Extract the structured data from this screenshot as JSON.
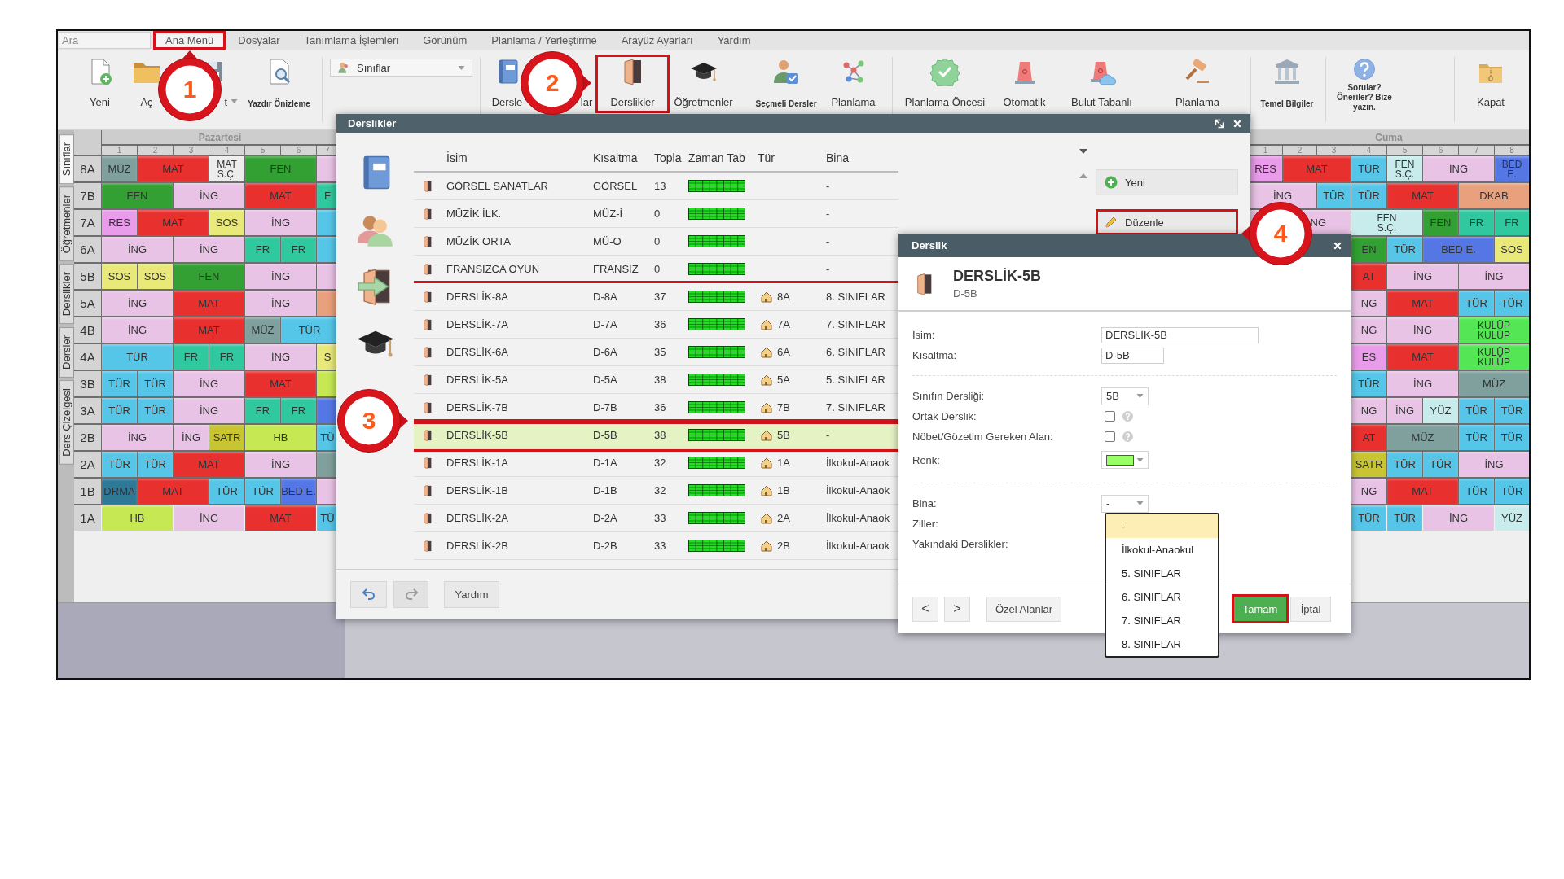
{
  "search": {
    "placeholder": "Ara"
  },
  "menu": [
    {
      "label": "Ana Menü",
      "selected": true,
      "highlighted": true
    },
    {
      "label": "Dosyalar",
      "selected": false,
      "highlighted": false
    },
    {
      "label": "Tanımlama İşlemleri",
      "selected": false,
      "highlighted": false
    },
    {
      "label": "Görünüm",
      "selected": false,
      "highlighted": false
    },
    {
      "label": "Planlama / Yerleştirme",
      "selected": false,
      "highlighted": false
    },
    {
      "label": "Arayüz Ayarları",
      "selected": false,
      "highlighted": false
    },
    {
      "label": "Yardım",
      "selected": false,
      "highlighted": false
    }
  ],
  "toolbar": [
    {
      "kind": "large",
      "label": "Yeni",
      "highlighted": false
    },
    {
      "kind": "large",
      "label": "Aç",
      "highlighted": false
    },
    {
      "kind": "menu",
      "label": "t",
      "highlighted": false
    },
    {
      "kind": "small",
      "label": "Yazdır Önizleme",
      "highlighted": false
    },
    {
      "kind": "select",
      "value": "Sınıflar",
      "highlighted": false
    },
    {
      "kind": "large",
      "label": "Dersle",
      "highlighted": false
    },
    {
      "kind": "large",
      "label": "lar",
      "highlighted": false
    },
    {
      "kind": "large",
      "label": "Derslikler",
      "highlighted": true
    },
    {
      "kind": "large",
      "label": "Öğretmenler",
      "highlighted": false
    },
    {
      "kind": "small",
      "label": "Seçmeli Dersler",
      "highlighted": false
    },
    {
      "kind": "large",
      "label": "Planlama",
      "highlighted": false
    },
    {
      "kind": "large",
      "label": "Planlama Öncesi",
      "highlighted": false
    },
    {
      "kind": "large",
      "label": "Otomatik",
      "highlighted": false
    },
    {
      "kind": "large",
      "label": "Bulut Tabanlı",
      "highlighted": false
    },
    {
      "kind": "large",
      "label": "Planlama",
      "highlighted": false
    },
    {
      "kind": "small",
      "label": "Temel Bilgiler",
      "highlighted": false
    },
    {
      "kind": "small",
      "label": "Sorular? Öneriler? Bize yazın.",
      "highlighted": false
    },
    {
      "kind": "large",
      "label": "Kapat",
      "highlighted": false
    }
  ],
  "view_tabs": [
    {
      "label": "Sınıflar",
      "selected": true
    },
    {
      "label": "Öğretmenler",
      "selected": false
    },
    {
      "label": "Derslikler",
      "selected": false
    },
    {
      "label": "Dersler",
      "selected": false
    },
    {
      "label": "Ders Çizelgesi",
      "selected": false
    }
  ],
  "timetable_left": {
    "day": "Pazartesi",
    "periods": [
      "1",
      "2",
      "3",
      "4",
      "5",
      "6",
      "7"
    ],
    "rows": [
      {
        "class": "8A",
        "cells": [
          {
            "text": "MÜZ",
            "color": "#7fa09c"
          },
          {
            "text": "MAT",
            "color": "#e8302f"
          },
          {
            "lines": [
              "MAT",
              "S.Ç."
            ],
            "color": "#ececec"
          },
          {
            "text": "FEN",
            "color": "#32a032"
          },
          {
            "color": "#e9c3e6"
          }
        ]
      },
      {
        "class": "7B",
        "cells": [
          {
            "text": "FEN",
            "color": "#32a032"
          },
          {
            "text": "İNG",
            "color": "#e9c3e6"
          },
          {
            "text": "MAT",
            "color": "#e8302f"
          },
          {
            "text": "F",
            "color": "#30c89e"
          }
        ]
      },
      {
        "class": "7A",
        "cells": [
          {
            "text": "RES",
            "color": "#e99ce9"
          },
          {
            "text": "MAT",
            "color": "#e8302f"
          },
          {
            "text": "SOS",
            "color": "#e9e97a"
          },
          {
            "text": "İNG",
            "color": "#e9c3e6"
          },
          {
            "color": "#56c6e8"
          }
        ]
      },
      {
        "class": "6A",
        "cells": [
          {
            "text": "İNG",
            "color": "#e9c3e6"
          },
          {
            "text": "İNG",
            "color": "#e9c3e6"
          },
          {
            "text": "FR",
            "color": "#30c89e"
          },
          {
            "text": "FR",
            "color": "#30c89e"
          },
          {
            "color": "#56c6e8"
          }
        ]
      },
      {
        "class": "5B",
        "cells": [
          {
            "text": "SOS",
            "color": "#e9e97a"
          },
          {
            "text": "SOS",
            "color": "#e9e97a"
          },
          {
            "text": "FEN",
            "color": "#32a032"
          },
          {
            "text": "İNG",
            "color": "#e9c3e6"
          },
          {
            "color": "#e9c3e6"
          }
        ]
      },
      {
        "class": "5A",
        "cells": [
          {
            "text": "İNG",
            "color": "#e9c3e6"
          },
          {
            "text": "MAT",
            "color": "#e8302f"
          },
          {
            "text": "İNG",
            "color": "#e9c3e6"
          },
          {
            "color": "#e9a07c"
          }
        ]
      },
      {
        "class": "4B",
        "cells": [
          {
            "text": "İNG",
            "color": "#e9c3e6"
          },
          {
            "text": "MAT",
            "color": "#e8302f"
          },
          {
            "text": "MÜZ",
            "color": "#7fa09c"
          },
          {
            "text": "TÜR",
            "color": "#56c6e8"
          }
        ]
      },
      {
        "class": "4A",
        "cells": [
          {
            "text": "TÜR",
            "color": "#56c6e8"
          },
          {
            "text": "FR",
            "color": "#30c89e"
          },
          {
            "text": "FR",
            "color": "#30c89e"
          },
          {
            "text": "İNG",
            "color": "#e9c3e6"
          },
          {
            "text": "S",
            "color": "#e9e97a"
          }
        ]
      },
      {
        "class": "3B",
        "cells": [
          {
            "text": "TÜR",
            "color": "#56c6e8"
          },
          {
            "text": "TÜR",
            "color": "#56c6e8"
          },
          {
            "text": "İNG",
            "color": "#e9c3e6"
          },
          {
            "text": "MAT",
            "color": "#e8302f"
          },
          {
            "color": "#c6e852"
          }
        ]
      },
      {
        "class": "3A",
        "cells": [
          {
            "text": "TÜR",
            "color": "#56c6e8"
          },
          {
            "text": "TÜR",
            "color": "#56c6e8"
          },
          {
            "text": "İNG",
            "color": "#e9c3e6"
          },
          {
            "text": "FR",
            "color": "#30c89e"
          },
          {
            "text": "FR",
            "color": "#30c89e"
          },
          {
            "color": "#5577e6"
          }
        ]
      },
      {
        "class": "2B",
        "cells": [
          {
            "text": "İNG",
            "color": "#e9c3e6"
          },
          {
            "text": "İNG",
            "color": "#e9c3e6"
          },
          {
            "text": "SATR",
            "color": "#c8c432"
          },
          {
            "text": "HB",
            "color": "#c6e852"
          },
          {
            "text": "TÜ",
            "color": "#56c6e8"
          }
        ]
      },
      {
        "class": "2A",
        "cells": [
          {
            "text": "TÜR",
            "color": "#56c6e8"
          },
          {
            "text": "TÜR",
            "color": "#56c6e8"
          },
          {
            "text": "MAT",
            "color": "#e8302f"
          },
          {
            "text": "İNG",
            "color": "#e9c3e6"
          },
          {
            "color": "#7fa09c"
          }
        ]
      },
      {
        "class": "1B",
        "cells": [
          {
            "text": "DRMA",
            "color": "#2e7898"
          },
          {
            "text": "MAT",
            "color": "#e8302f"
          },
          {
            "text": "TÜR",
            "color": "#56c6e8"
          },
          {
            "text": "TÜR",
            "color": "#56c6e8"
          },
          {
            "text": "BED E.",
            "color": "#5577e6"
          },
          {
            "color": "#e9c3e6"
          }
        ]
      },
      {
        "class": "1A",
        "cells": [
          {
            "text": "HB",
            "color": "#c6e852"
          },
          {
            "text": "İNG",
            "color": "#e9c3e6"
          },
          {
            "text": "MAT",
            "color": "#e8302f"
          },
          {
            "text": "TÜ",
            "color": "#56c6e8"
          }
        ]
      }
    ]
  },
  "timetable_right": {
    "day": "Cuma",
    "periods": [
      "1",
      "2",
      "3",
      "4",
      "5",
      "6",
      "7",
      "8"
    ],
    "rows": [
      {
        "cells": [
          {
            "text": "RES",
            "color": "#e99ce9"
          },
          {
            "text": "MAT",
            "color": "#e8302f"
          },
          {
            "text": "TÜR",
            "color": "#56c6e8"
          },
          {
            "lines": [
              "FEN",
              "S.Ç."
            ],
            "color": "#c8ecec"
          },
          {
            "text": "İNG",
            "color": "#e9c3e6"
          },
          {
            "lines": [
              "BED",
              "E."
            ],
            "color": "#5577e6"
          }
        ]
      },
      {
        "cells": [
          {
            "text": "İNG",
            "color": "#e9c3e6"
          },
          {
            "text": "TÜR",
            "color": "#56c6e8"
          },
          {
            "text": "TÜR",
            "color": "#56c6e8"
          },
          {
            "text": "MAT",
            "color": "#e8302f"
          },
          {
            "text": "DKAB",
            "color": "#e9a07c"
          }
        ]
      },
      {
        "cells": [
          {
            "color": "#e9c3e6"
          },
          {
            "text": "NG",
            "color": "#e9c3e6"
          },
          {
            "lines": [
              "FEN",
              "S.Ç."
            ],
            "color": "#c8ecec"
          },
          {
            "text": "FEN",
            "color": "#32a032"
          },
          {
            "text": "FR",
            "color": "#30c89e"
          },
          {
            "text": "FR",
            "color": "#30c89e"
          }
        ]
      },
      {
        "cells": [
          "",
          "",
          "",
          {
            "text": "EN",
            "color": "#32a032"
          },
          {
            "text": "TÜR",
            "color": "#56c6e8"
          },
          {
            "text": "BED E.",
            "color": "#5577e6"
          },
          {
            "text": "SOS",
            "color": "#e9e97a"
          }
        ]
      },
      {
        "cells": [
          "",
          "",
          "",
          {
            "text": "AT",
            "color": "#e8302f"
          },
          {
            "text": "İNG",
            "color": "#e9c3e6"
          },
          {
            "text": "İNG",
            "color": "#e9c3e6"
          }
        ]
      },
      {
        "cells": [
          "",
          "",
          "",
          {
            "text": "NG",
            "color": "#e9c3e6"
          },
          {
            "text": "MAT",
            "color": "#e8302f"
          },
          {
            "text": "TÜR",
            "color": "#56c6e8"
          },
          {
            "text": "TÜR",
            "color": "#56c6e8"
          }
        ]
      },
      {
        "cells": [
          "",
          "",
          "",
          {
            "text": "NG",
            "color": "#e9c3e6"
          },
          {
            "text": "İNG",
            "color": "#e9c3e6"
          },
          {
            "lines": [
              "KULÜP",
              "KULÜP"
            ],
            "color": "#55e655"
          }
        ]
      },
      {
        "cells": [
          "",
          "",
          "",
          {
            "text": "ES",
            "color": "#e99ce9"
          },
          {
            "text": "MAT",
            "color": "#e8302f"
          },
          {
            "lines": [
              "KULÜP",
              "KULÜP"
            ],
            "color": "#55e655"
          }
        ]
      },
      {
        "cells": [
          "",
          "",
          "",
          {
            "text": "TÜR",
            "color": "#56c6e8"
          },
          {
            "text": "İNG",
            "color": "#e9c3e6"
          },
          {
            "text": "MÜZ",
            "color": "#7fa09c"
          }
        ]
      },
      {
        "cells": [
          "",
          "",
          "",
          {
            "text": "NG",
            "color": "#e9c3e6"
          },
          {
            "text": "İNG",
            "color": "#e9c3e6"
          },
          {
            "text": "YÜZ",
            "color": "#c8ecec"
          },
          {
            "text": "TÜR",
            "color": "#56c6e8"
          },
          {
            "text": "TÜR",
            "color": "#56c6e8"
          }
        ]
      },
      {
        "cells": [
          "",
          "",
          "",
          {
            "text": "AT",
            "color": "#e8302f"
          },
          {
            "text": "MÜZ",
            "color": "#7fa09c"
          },
          {
            "text": "TÜR",
            "color": "#56c6e8"
          },
          {
            "text": "TÜR",
            "color": "#56c6e8"
          }
        ]
      },
      {
        "cells": [
          "",
          "",
          "",
          {
            "text": "SATR",
            "color": "#c8c432"
          },
          {
            "text": "TÜR",
            "color": "#56c6e8"
          },
          {
            "text": "TÜR",
            "color": "#56c6e8"
          },
          {
            "text": "İNG",
            "color": "#e9c3e6"
          }
        ]
      },
      {
        "cells": [
          "",
          "",
          "",
          {
            "text": "NG",
            "color": "#e9c3e6"
          },
          {
            "text": "MAT",
            "color": "#e8302f"
          },
          {
            "text": "TÜR",
            "color": "#56c6e8"
          },
          {
            "text": "TÜR",
            "color": "#56c6e8"
          }
        ]
      },
      {
        "cells": [
          "",
          "",
          "",
          {
            "text": "TÜR",
            "color": "#56c6e8"
          },
          {
            "text": "TÜR",
            "color": "#56c6e8"
          },
          {
            "text": "İNG",
            "color": "#e9c3e6"
          },
          {
            "text": "YÜZ",
            "color": "#c8ecec"
          }
        ]
      }
    ]
  },
  "rooms_window": {
    "title": "Derslikler",
    "columns": [
      "İsim",
      "Kısaltma",
      "Topla",
      "Zaman Tab",
      "Tür",
      "Bina"
    ],
    "rows": [
      {
        "name": "GÖRSEL SANATLAR",
        "short": "GÖRSEL",
        "total": "13",
        "building": "-",
        "selected": false,
        "framed": false
      },
      {
        "name": "MÜZİK İLK.",
        "short": "MÜZ-İ",
        "total": "0",
        "building": "-",
        "selected": false,
        "framed": false
      },
      {
        "name": "MÜZİK ORTA",
        "short": "MÜ-O",
        "total": "0",
        "building": "-",
        "selected": false,
        "framed": false
      },
      {
        "name": "FRANSIZCA OYUN",
        "short": "FRANSIZ",
        "total": "0",
        "building": "-",
        "selected": false,
        "framed": false
      },
      {
        "name": "DERSLİK-8A",
        "short": "D-8A",
        "total": "37",
        "class": "8A",
        "building": "8. SINIFLAR",
        "selected": false,
        "framed": true
      },
      {
        "name": "DERSLİK-7A",
        "short": "D-7A",
        "total": "36",
        "class": "7A",
        "building": "7. SINIFLAR",
        "selected": false,
        "framed": true
      },
      {
        "name": "DERSLİK-6A",
        "short": "D-6A",
        "total": "35",
        "class": "6A",
        "building": "6. SINIFLAR",
        "selected": false,
        "framed": true
      },
      {
        "name": "DERSLİK-5A",
        "short": "D-5A",
        "total": "38",
        "class": "5A",
        "building": "5. SINIFLAR",
        "selected": false,
        "framed": true
      },
      {
        "name": "DERSLİK-7B",
        "short": "D-7B",
        "total": "36",
        "class": "7B",
        "building": "7. SINIFLAR",
        "selected": false,
        "framed": true
      },
      {
        "name": "DERSLİK-5B",
        "short": "D-5B",
        "total": "38",
        "class": "5B",
        "building": "-",
        "selected": true,
        "framed": true
      },
      {
        "name": "DERSLİK-1A",
        "short": "D-1A",
        "total": "32",
        "class": "1A",
        "building": "İlkokul-Anaok",
        "selected": false,
        "framed": false
      },
      {
        "name": "DERSLİK-1B",
        "short": "D-1B",
        "total": "32",
        "class": "1B",
        "building": "İlkokul-Anaok",
        "selected": false,
        "framed": false
      },
      {
        "name": "DERSLİK-2A",
        "short": "D-2A",
        "total": "33",
        "class": "2A",
        "building": "İlkokul-Anaok",
        "selected": false,
        "framed": false
      },
      {
        "name": "DERSLİK-2B",
        "short": "D-2B",
        "total": "33",
        "class": "2B",
        "building": "İlkokul-Anaok",
        "selected": false,
        "framed": false
      }
    ],
    "side_buttons": [
      {
        "label": "Yeni",
        "highlighted": false
      },
      {
        "label": "Düzenle",
        "highlighted": true
      }
    ],
    "undo": {
      "disabled": false
    },
    "redo": {
      "disabled": true
    },
    "footer_buttons": [
      "Yardım"
    ]
  },
  "room_editor": {
    "title": "Derslik",
    "heading": "DERSLİK-5B",
    "subheading": "D-5B",
    "groups": [
      [
        {
          "kind": "text",
          "label": "İsim:",
          "value": "DERSLİK-5B"
        },
        {
          "kind": "text",
          "label": "Kısaltma:",
          "value": "D-5B"
        }
      ],
      [
        {
          "kind": "select",
          "label": "Sınıfın Dersliği:",
          "value": "5B",
          "open": false
        },
        {
          "kind": "checkbox",
          "label": "Ortak Derslik:",
          "checked": false
        },
        {
          "kind": "checkbox",
          "label": "Nöbet/Gözetim Gereken Alan:",
          "checked": false
        },
        {
          "kind": "color",
          "label": "Renk:",
          "color": "#99ff66"
        }
      ],
      [
        {
          "kind": "select",
          "label": "Bina:",
          "value": "-",
          "open": true,
          "options": [
            {
              "label": "-",
              "selected": true
            },
            {
              "label": "İlkokul-Anaokul",
              "selected": false
            },
            {
              "label": "5. SINIFLAR",
              "selected": false
            },
            {
              "label": "6. SINIFLAR",
              "selected": false
            },
            {
              "label": "7. SINIFLAR",
              "selected": false
            },
            {
              "label": "8. SINIFLAR",
              "selected": false
            }
          ]
        },
        {
          "kind": "label",
          "label": "Ziller:"
        },
        {
          "kind": "label",
          "label": "Yakındaki Derslikler:"
        }
      ]
    ],
    "buttons": [
      {
        "kind": "nav",
        "label": "<",
        "highlighted": false
      },
      {
        "kind": "nav",
        "label": ">",
        "highlighted": false
      },
      {
        "kind": "plain",
        "label": "Özel Alanlar",
        "highlighted": false
      },
      {
        "kind": "primary",
        "label": "Tamam",
        "highlighted": true
      },
      {
        "kind": "plain",
        "label": "İptal",
        "highlighted": false
      }
    ]
  },
  "callouts": [
    {
      "number": "1"
    },
    {
      "number": "2"
    },
    {
      "number": "3"
    },
    {
      "number": "4"
    }
  ]
}
